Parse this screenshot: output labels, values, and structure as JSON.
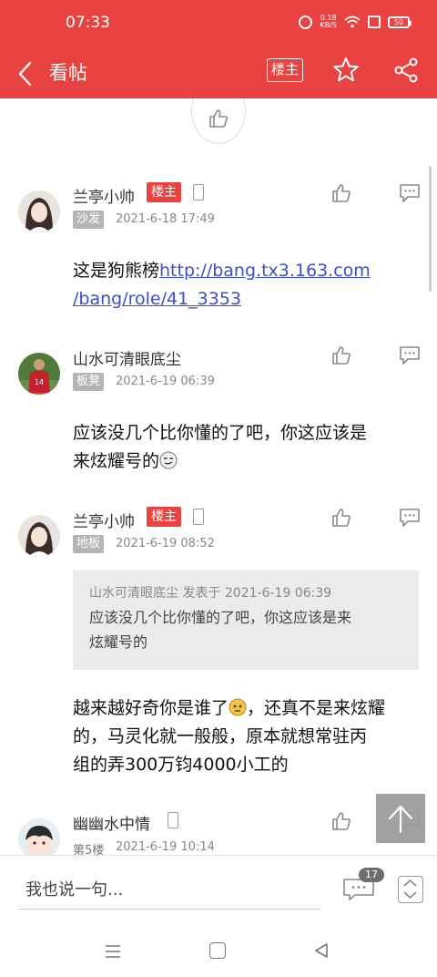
{
  "status_bar": {
    "time": "07:33",
    "net_speed_value": "0.18",
    "net_speed_unit": "KB/S",
    "battery": "50"
  },
  "header": {
    "title": "看帖",
    "op_only_label": "楼主"
  },
  "posts": [
    {
      "username": "兰亭小帅",
      "host_tag": "楼主",
      "floor": "沙发",
      "time": "2021-6-18 17:49",
      "text_prefix": "这是狗熊榜",
      "link_line1": "http://bang.tx3.163.com",
      "link_line2": "/bang/role/41_3353"
    },
    {
      "username": "山水可清眼底尘",
      "floor": "板凳",
      "time": "2021-6-19 06:39",
      "text_line1": "应该没几个比你懂的了吧，你这应该是",
      "text_line2": "来炫耀号的"
    },
    {
      "username": "兰亭小帅",
      "host_tag": "楼主",
      "floor": "地板",
      "time": "2021-6-19 08:52",
      "quote_header": "山水可清眼底尘 发表于 2021-6-19 06:39",
      "quote_line1": "应该没几个比你懂的了吧，你这应该是来",
      "quote_line2": "炫耀号的",
      "text_line1a": "越来越好奇你是谁了",
      "text_line1b": "，还真不是来炫耀",
      "text_line2": "的，马灵化就一般般，原本就想常驻丙",
      "text_line3": "组的弄300万钧4000小工的"
    },
    {
      "username": "幽幽水中情",
      "floor": "第5楼",
      "time": "2021-6-19 10:14"
    }
  ],
  "bottom_bar": {
    "input_placeholder": "我也说一句...",
    "comment_count": "17"
  },
  "colors": {
    "brand_red": "#e84241",
    "link_blue": "#3d4fc8",
    "floor_tag_gray": "#b5b5b5"
  },
  "icons": [
    "back-arrow-icon",
    "star-icon",
    "share-icon",
    "thumbs-up-icon",
    "comment-icon",
    "phone-icon",
    "arrow-up-icon",
    "page-up-down-icon",
    "nav-menu-icon",
    "nav-home-icon",
    "nav-back-icon"
  ]
}
